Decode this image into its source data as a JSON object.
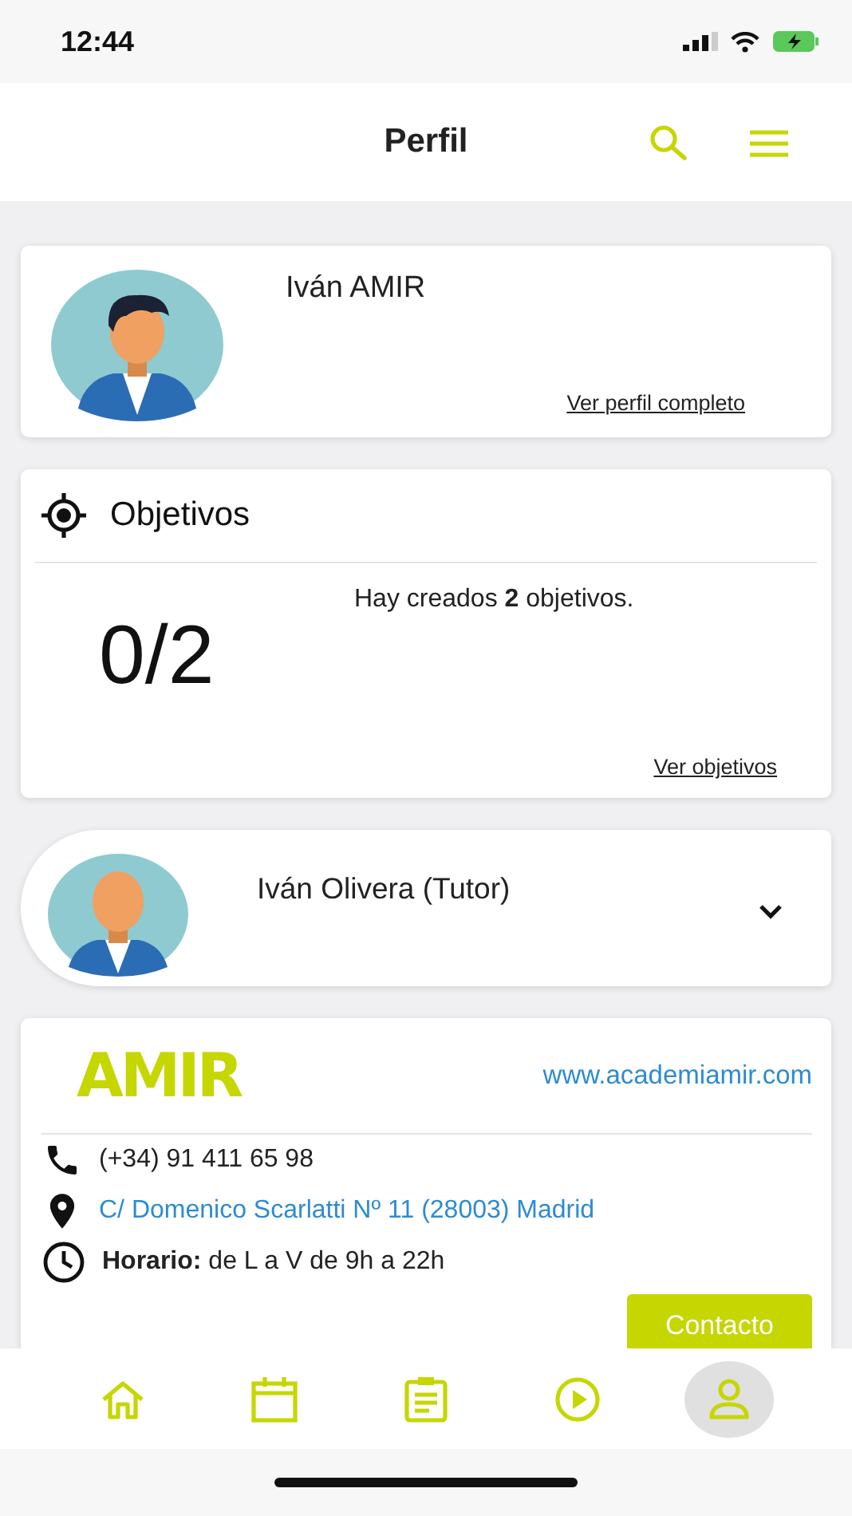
{
  "status_bar": {
    "time": "12:44"
  },
  "header": {
    "title": "Perfil"
  },
  "profile": {
    "name": "Iván AMIR",
    "link": "Ver perfil completo"
  },
  "objectives": {
    "title": "Objetivos",
    "count": "0/2",
    "summary": "Hay creados **2** objetivos.",
    "link": "Ver objetivos"
  },
  "tutor": {
    "name": "Iván Olivera (Tutor)",
    "expanded": false
  },
  "academy": {
    "logo": "AMIR",
    "website": "www.academiamir.com",
    "phone": "(+34) 91 411 65 98",
    "address": "C/ Domenico Scarlatti Nº 11 (28003) Madrid",
    "hours": "**Horario:** de L a V de 9h a 22h",
    "button": "Contacto"
  },
  "tab_bar": [
    {
      "kind": "home",
      "selected": false
    },
    {
      "kind": "calendar",
      "selected": false
    },
    {
      "kind": "clipboard",
      "selected": false
    },
    {
      "kind": "play",
      "selected": false
    },
    {
      "kind": "profile",
      "selected": true
    }
  ]
}
